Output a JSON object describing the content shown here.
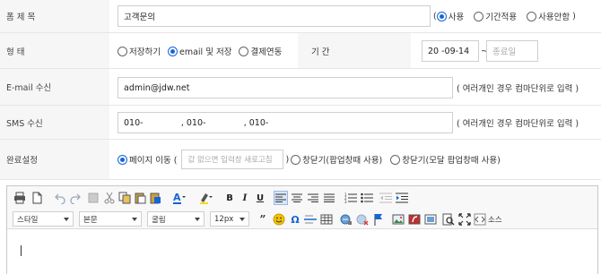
{
  "form": {
    "title": {
      "label": "폼 제 목",
      "value": "고객문의",
      "paren_open": "(",
      "paren_close": ")",
      "options": [
        "사용",
        "기간적용",
        "사용안함"
      ]
    },
    "type": {
      "label": "형 태",
      "options": [
        "저장하기",
        "email 및 저장",
        "결제연동"
      ],
      "period_label": "기 간",
      "date_value": "20   -09-14",
      "tilde": "~",
      "end_placeholder": "종료일"
    },
    "email": {
      "label": "E-mail 수신",
      "value": "admin@jdw.net",
      "hint": "( 여러개인 경우 컴마단위로 입력 )"
    },
    "sms": {
      "label": "SMS 수신",
      "value": "010-              , 010-              , 010-",
      "hint": "( 여러개인 경우 컴마단위로 입력 )"
    },
    "complete": {
      "label": "완료설정",
      "option_page": "페이지 이동 (",
      "page_placeholder": "값 없으면 입력창 새로고침",
      "paren_close": ")",
      "options": [
        "창닫기(팝업창때 사용)",
        "창닫기(모달 팝업창때 사용)"
      ]
    }
  },
  "editor": {
    "selects": {
      "style": "스타일",
      "format": "본문",
      "font": "굴림",
      "size": "12px"
    },
    "source_label": "소스",
    "colors": {
      "accent": "#1565d8",
      "align_active": "#d8e6f8"
    }
  }
}
